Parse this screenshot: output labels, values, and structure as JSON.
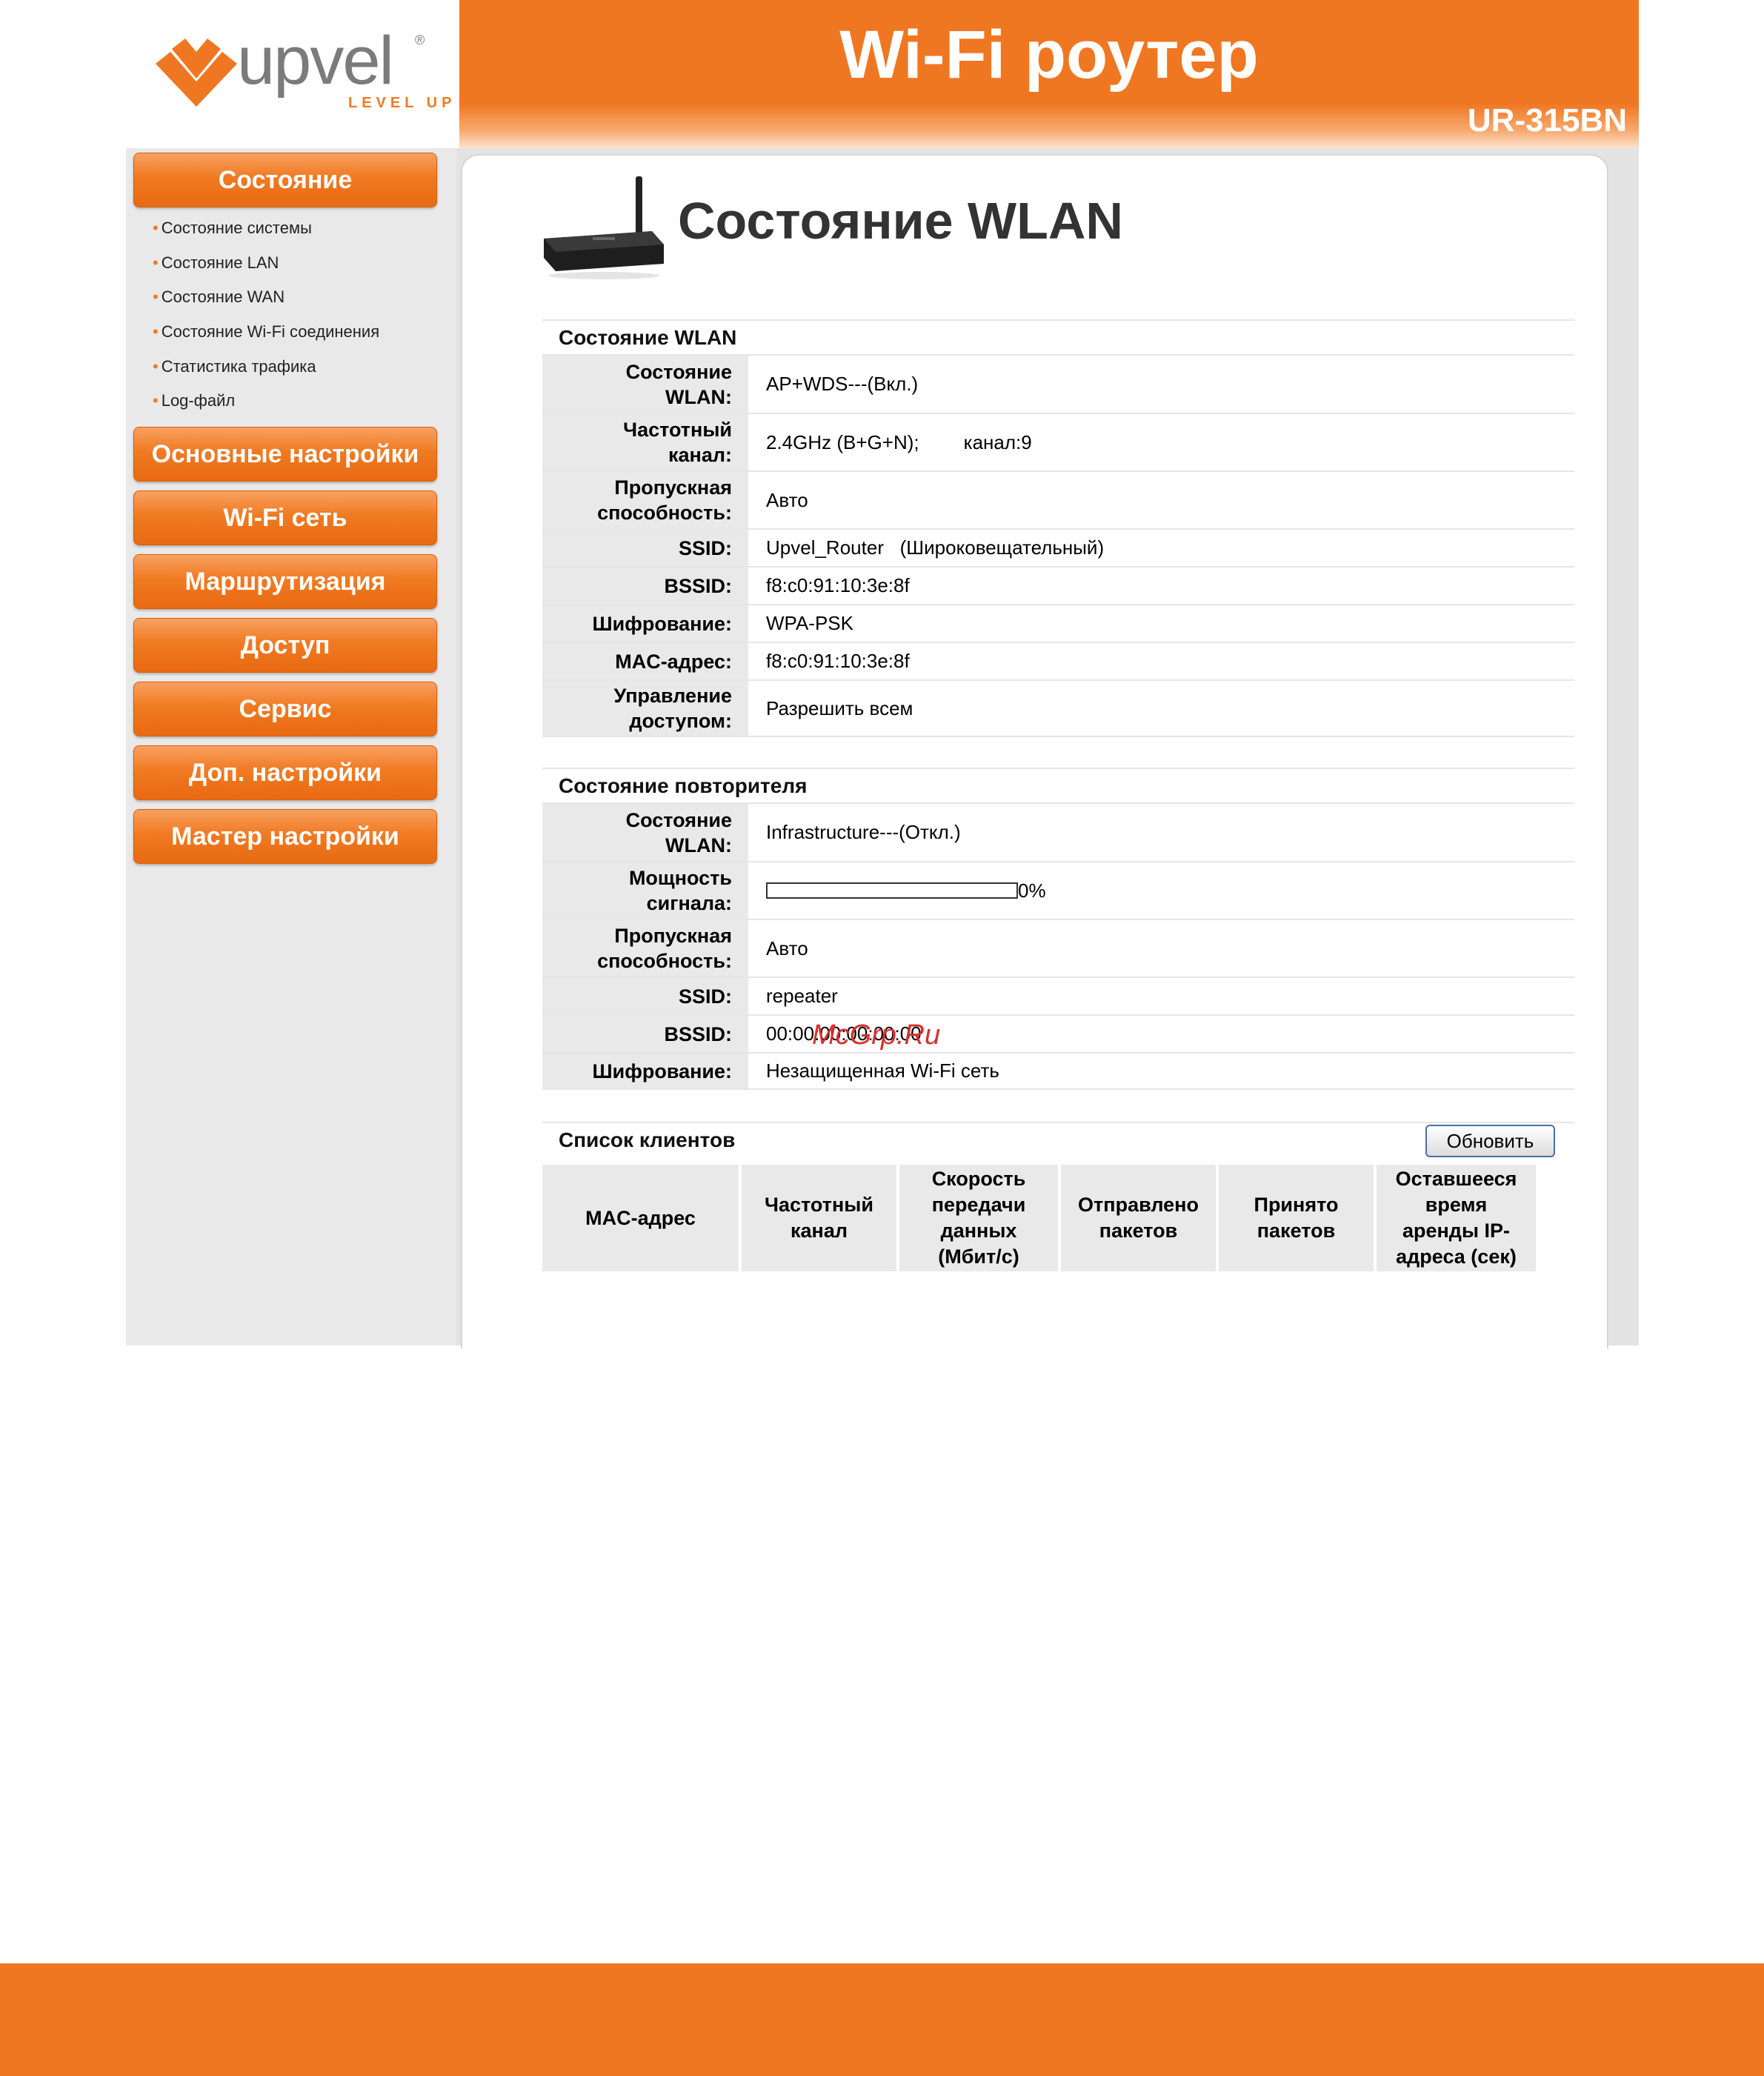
{
  "logo": {
    "word": "upvel",
    "registered": "®",
    "tagline": "LEVEL UP"
  },
  "banner": {
    "title": "Wi-Fi роутер",
    "model": "UR-315BN"
  },
  "sidebar": {
    "main_items": [
      {
        "label": "Состояние"
      },
      {
        "label": "Основные настройки"
      },
      {
        "label": "Wi-Fi сеть"
      },
      {
        "label": "Маршрутизация"
      },
      {
        "label": "Доступ"
      },
      {
        "label": "Сервис"
      },
      {
        "label": "Доп. настройки"
      },
      {
        "label": "Мастер настройки"
      }
    ],
    "sub_items": [
      {
        "label": "Состояние системы"
      },
      {
        "label": "Состояние LAN"
      },
      {
        "label": "Состояние WAN"
      },
      {
        "label": "Состояние Wi-Fi соединения"
      },
      {
        "label": "Статистика трафика"
      },
      {
        "label": "Log-файл"
      }
    ]
  },
  "page": {
    "title": "Состояние WLAN"
  },
  "wlan": {
    "heading": "Состояние WLAN",
    "rows": [
      {
        "label": "Состояние\nWLAN:",
        "value": "AP+WDS---(Вкл.)"
      },
      {
        "label": "Частотный\nканал:",
        "value": "2.4GHz (B+G+N);",
        "extra": "канал:9"
      },
      {
        "label": "Пропускная\nспособность:",
        "value": "Авто"
      },
      {
        "label": "SSID:",
        "value": "Upvel_Router   (Широковещательный)"
      },
      {
        "label": "BSSID:",
        "value": "f8:c0:91:10:3e:8f"
      },
      {
        "label": "Шифрование:",
        "value": "WPA-PSK"
      },
      {
        "label": "MAC-адрес:",
        "value": "f8:c0:91:10:3e:8f"
      },
      {
        "label": "Управление\nдоступом:",
        "value": "Разрешить всем"
      }
    ]
  },
  "repeater": {
    "heading": "Состояние повторителя",
    "rows": [
      {
        "label": "Состояние\nWLAN:",
        "value": "Infrastructure---(Откл.)"
      },
      {
        "label": "Мощность\nсигнала:",
        "value": "0%"
      },
      {
        "label": "Пропускная\nспособность:",
        "value": "Авто"
      },
      {
        "label": "SSID:",
        "value": "repeater"
      },
      {
        "label": "BSSID:",
        "value": "00:00:00:00:00:00"
      },
      {
        "label": "Шифрование:",
        "value": "Незащищенная Wi-Fi сеть"
      }
    ],
    "signal_level": 0
  },
  "clients": {
    "heading": "Список клиентов",
    "refresh_label": "Обновить",
    "columns": [
      "MAC-адрес",
      "Частотный\nканал",
      "Скорость\nпередачи\nданных\n(Мбит/с)",
      "Отправлено\nпакетов",
      "Принято\nпакетов",
      "Оставшееся\nвремя\nаренды IP-\nадреса (сек)"
    ]
  },
  "watermark": "McGrp.Ru",
  "colors": {
    "brand_orange": "#f07722",
    "panel_grey": "#e9e9e9",
    "logo_grey": "#7b7b7b"
  }
}
